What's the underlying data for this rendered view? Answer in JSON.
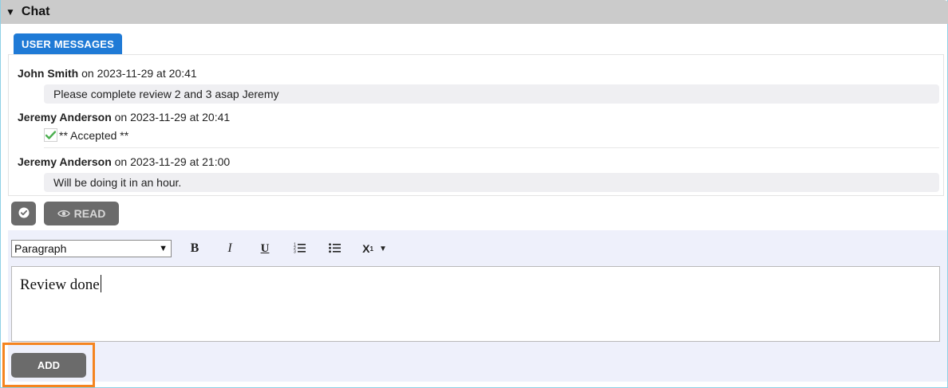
{
  "header": {
    "title": "Chat",
    "toggle_icon": "triangle-down-icon"
  },
  "tab": {
    "label": "USER MESSAGES",
    "color": "#1f7ad6"
  },
  "messages": [
    {
      "author": "John Smith",
      "meta": " on 2023-11-29 at 20:41",
      "text": "Please complete review 2 and 3 asap Jeremy"
    },
    {
      "author": "Jeremy Anderson",
      "meta": " on 2023-11-29 at 20:41",
      "text": "** Accepted **"
    },
    {
      "author": "Jeremy Anderson",
      "meta": " on 2023-11-29 at 21:00",
      "text": "Will be doing it in an hour."
    }
  ],
  "actions": {
    "read_label": "READ",
    "check_icon": "check-circle-icon",
    "eye_icon": "eye-icon"
  },
  "editor": {
    "format_value": "Paragraph",
    "bold_label": "B",
    "italic_label": "I",
    "underline_label": "U",
    "subscript_label": "X",
    "subscript_index": "1",
    "content": "Review done"
  },
  "add_label": "ADD",
  "colors": {
    "highlight": "#f5841f",
    "button": "#6b6b6b",
    "header": "#cbcbcb",
    "editor_bg": "#eef0fb"
  }
}
